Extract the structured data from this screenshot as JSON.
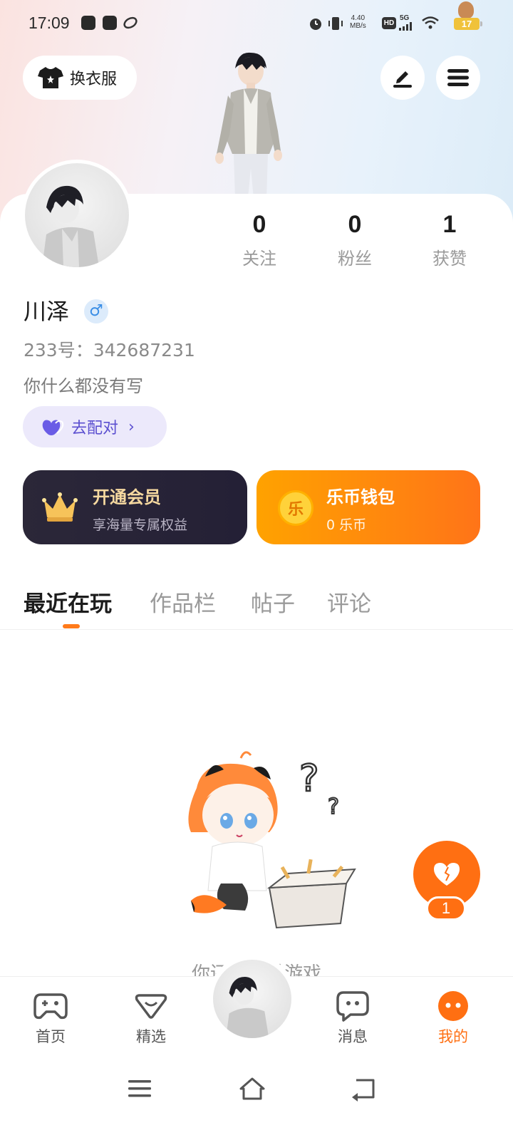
{
  "status_bar": {
    "time": "17:09",
    "net_speed_value": "4.40",
    "net_speed_unit": "MB/s",
    "hd": "HD",
    "network": "5G",
    "battery": "17"
  },
  "header": {
    "outfit_label": "换衣服"
  },
  "stats": [
    {
      "value": "0",
      "label": "关注"
    },
    {
      "value": "0",
      "label": "粉丝"
    },
    {
      "value": "1",
      "label": "获赞"
    }
  ],
  "profile": {
    "name": "川泽",
    "gender_symbol": "♂",
    "uid": "233号：342687231",
    "bio": "你什么都没有写",
    "match_label": "去配对",
    "match_chevron": "›"
  },
  "cards": {
    "vip": {
      "title": "开通会员",
      "subtitle": "享海量专属权益"
    },
    "wallet": {
      "title": "乐币钱包",
      "subtitle": "0 乐币",
      "coin_glyph": "乐"
    }
  },
  "tabs": [
    {
      "label": "最近在玩",
      "active": true
    },
    {
      "label": "作品栏",
      "active": false
    },
    {
      "label": "帖子",
      "active": false
    },
    {
      "label": "评论",
      "active": false
    }
  ],
  "empty_state": {
    "text": "你还没玩过游戏"
  },
  "like_fab": {
    "count": "1"
  },
  "bottom_nav": [
    {
      "label": "首页",
      "icon": "gamepad-icon"
    },
    {
      "label": "精选",
      "icon": "heart-box-icon"
    },
    {
      "label": "消息",
      "icon": "chat-bubble-icon"
    },
    {
      "label": "我的",
      "icon": "face-icon",
      "active": true
    }
  ],
  "colors": {
    "accent": "#ff6f12",
    "match": "#5b4fd0",
    "vip_title": "#f6d9a0"
  }
}
